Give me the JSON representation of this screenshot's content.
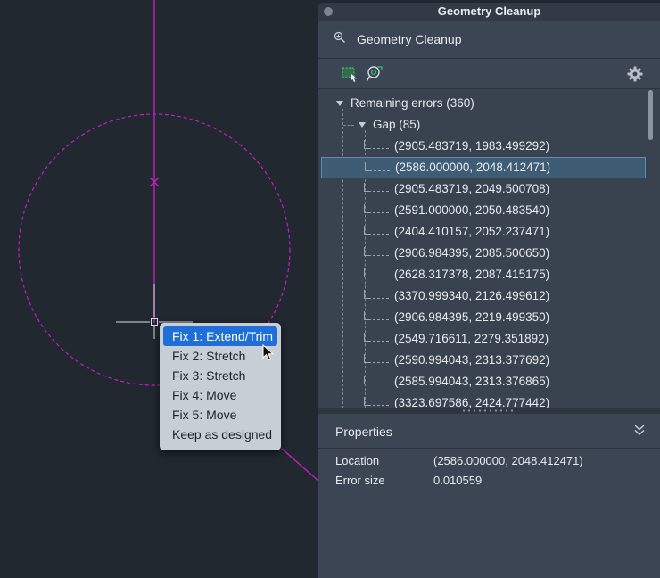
{
  "canvas": {
    "construction_color": "#c21ec2",
    "background": "#212830"
  },
  "context_menu": {
    "items": [
      {
        "label": "Fix 1: Extend/Trim",
        "active": true
      },
      {
        "label": "Fix 2: Stretch",
        "active": false
      },
      {
        "label": "Fix 3: Stretch",
        "active": false
      },
      {
        "label": "Fix 4: Move",
        "active": false
      },
      {
        "label": "Fix 5: Move",
        "active": false
      },
      {
        "label": "Keep as designed",
        "active": false
      }
    ]
  },
  "panel": {
    "window_title": "Geometry Cleanup",
    "header_title": "Geometry Cleanup",
    "header_icon": "find-errors-icon",
    "toolbar": {
      "select_icon": "select-geometry-icon",
      "analyze_icon": "analyze-icon",
      "settings_icon": "gear-icon"
    },
    "tree": {
      "root_label": "Remaining errors (360)",
      "group_label": "Gap (85)",
      "selected_index": 1,
      "items": [
        "(2905.483719, 1983.499292)",
        "(2586.000000, 2048.412471)",
        "(2905.483719, 2049.500708)",
        "(2591.000000, 2050.483540)",
        "(2404.410157, 2052.237471)",
        "(2906.984395, 2085.500650)",
        "(2628.317378, 2087.415175)",
        "(3370.999340, 2126.499612)",
        "(2906.984395, 2219.499350)",
        "(2549.716611, 2279.351892)",
        "(2590.994043, 2313.377692)",
        "(2585.994043, 2313.376865)",
        "(3323.697586, 2424.777442)"
      ]
    },
    "properties": {
      "title": "Properties",
      "location_label": "Location",
      "location_value": "(2586.000000, 2048.412471)",
      "error_size_label": "Error size",
      "error_size_value": "0.010559"
    }
  }
}
